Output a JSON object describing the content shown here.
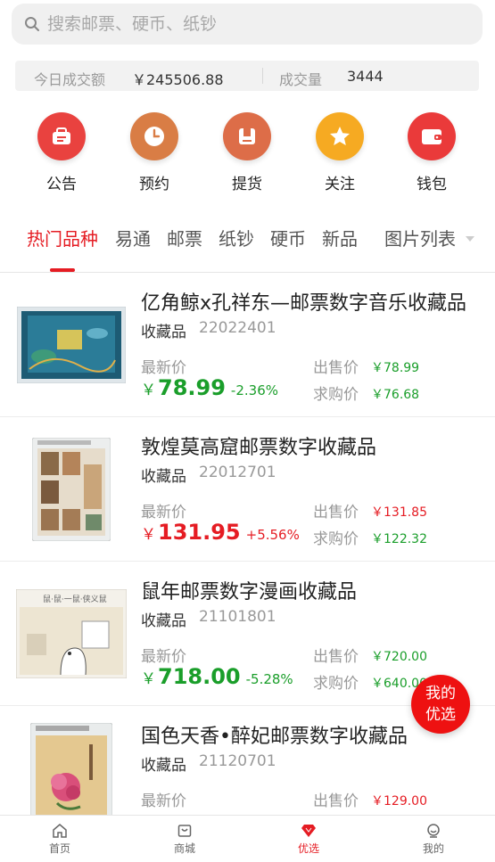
{
  "search": {
    "placeholder": "搜索邮票、硬币、纸钞"
  },
  "stats": {
    "turnover_label": "今日成交额",
    "turnover_value": "￥245506.88",
    "volume_label": "成交量",
    "volume_value": "3444"
  },
  "quick_actions": [
    {
      "label": "公告",
      "icon": "announcement-icon",
      "color": "#e9423f"
    },
    {
      "label": "预约",
      "icon": "clock-icon",
      "color": "#d97d45"
    },
    {
      "label": "提货",
      "icon": "pickup-box-icon",
      "color": "#dd6d48"
    },
    {
      "label": "关注",
      "icon": "star-icon",
      "color": "#f6aa22"
    },
    {
      "label": "钱包",
      "icon": "wallet-icon",
      "color": "#ea3a3a"
    }
  ],
  "tabs": [
    "热门品种",
    "易通",
    "邮票",
    "纸钞",
    "硬币",
    "新品"
  ],
  "view_toggle": "图片列表",
  "list": [
    {
      "title": "亿角鲸x孔祥东—邮票数字音乐收藏品",
      "category": "收藏品",
      "code": "22022401",
      "latest_label": "最新价",
      "currency": "￥",
      "latest_price": "78.99",
      "change": "-2.36%",
      "trend": "down",
      "sell_label": "出售价",
      "sell_price": "￥78.99",
      "bid_label": "求购价",
      "bid_price": "￥76.68"
    },
    {
      "title": "敦煌莫高窟邮票数字收藏品",
      "category": "收藏品",
      "code": "22012701",
      "latest_label": "最新价",
      "currency": "￥",
      "latest_price": "131.95",
      "change": "+5.56%",
      "trend": "up",
      "sell_label": "出售价",
      "sell_price": "￥131.85",
      "bid_label": "求购价",
      "bid_price": "￥122.32"
    },
    {
      "title": "鼠年邮票数字漫画收藏品",
      "category": "收藏品",
      "code": "21101801",
      "latest_label": "最新价",
      "currency": "￥",
      "latest_price": "718.00",
      "change": "-5.28%",
      "trend": "down",
      "sell_label": "出售价",
      "sell_price": "￥720.00",
      "bid_label": "求购价",
      "bid_price": "￥640.00"
    },
    {
      "title": "国色天香•醉妃邮票数字收藏品",
      "category": "收藏品",
      "code": "21120701",
      "latest_label": "最新价",
      "sell_label": "出售价",
      "sell_price": "￥129.00"
    }
  ],
  "float_button": {
    "line1": "我的",
    "line2": "优选"
  },
  "bottom_nav": [
    {
      "label": "首页",
      "icon": "home-icon"
    },
    {
      "label": "商城",
      "icon": "shop-icon"
    },
    {
      "label": "优选",
      "icon": "gem-icon",
      "active": true
    },
    {
      "label": "我的",
      "icon": "profile-icon"
    }
  ]
}
